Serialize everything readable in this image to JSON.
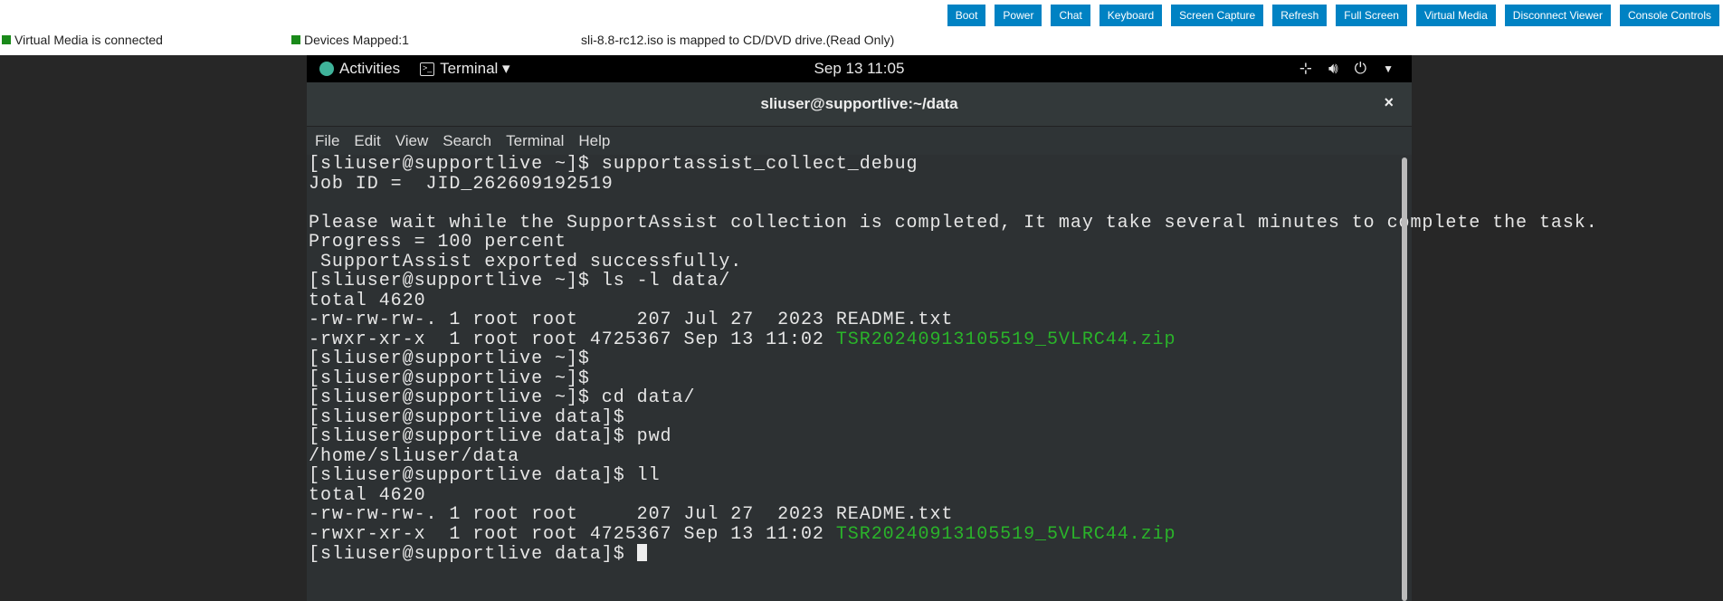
{
  "toolbar": {
    "buttons": [
      "Boot",
      "Power",
      "Chat",
      "Keyboard",
      "Screen Capture",
      "Refresh",
      "Full Screen",
      "Virtual Media",
      "Disconnect Viewer",
      "Console Controls"
    ]
  },
  "status": {
    "vm": "Virtual Media is connected",
    "devices": "Devices Mapped:1",
    "iso": "sli-8.8-rc12.iso is mapped to CD/DVD drive.(Read Only)"
  },
  "gnome": {
    "activities": "Activities",
    "app": "Terminal ▾",
    "clock": "Sep 13  11:05"
  },
  "window": {
    "title": "sliuser@supportlive:~/data",
    "close": "×"
  },
  "menu": [
    "File",
    "Edit",
    "View",
    "Search",
    "Terminal",
    "Help"
  ],
  "lines": [
    "[sliuser@supportlive ~]$ supportassist_collect_debug",
    "Job ID =  JID_262609192519",
    "",
    "Please wait while the SupportAssist collection is completed, It may take several minutes to complete the task.",
    "Progress = 100 percent",
    " SupportAssist exported successfully.",
    "[sliuser@supportlive ~]$ ls -l data/",
    "total 4620",
    "-rw-rw-rw-. 1 root root     207 Jul 27  2023 README.txt",
    "-rwxr-xr-x  1 root root 4725367 Sep 13 11:02 ",
    "[sliuser@supportlive ~]$",
    "[sliuser@supportlive ~]$",
    "[sliuser@supportlive ~]$ cd data/",
    "[sliuser@supportlive data]$",
    "[sliuser@supportlive data]$ pwd",
    "/home/sliuser/data",
    "[sliuser@supportlive data]$ ll",
    "total 4620",
    "-rw-rw-rw-. 1 root root     207 Jul 27  2023 README.txt",
    "-rwxr-xr-x  1 root root 4725367 Sep 13 11:02 ",
    "[sliuser@supportlive data]$ "
  ],
  "zipfile": "TSR20240913105519_5VLRC44.zip",
  "colors": {
    "button": "#0082c3",
    "zip": "#2ab32a"
  }
}
